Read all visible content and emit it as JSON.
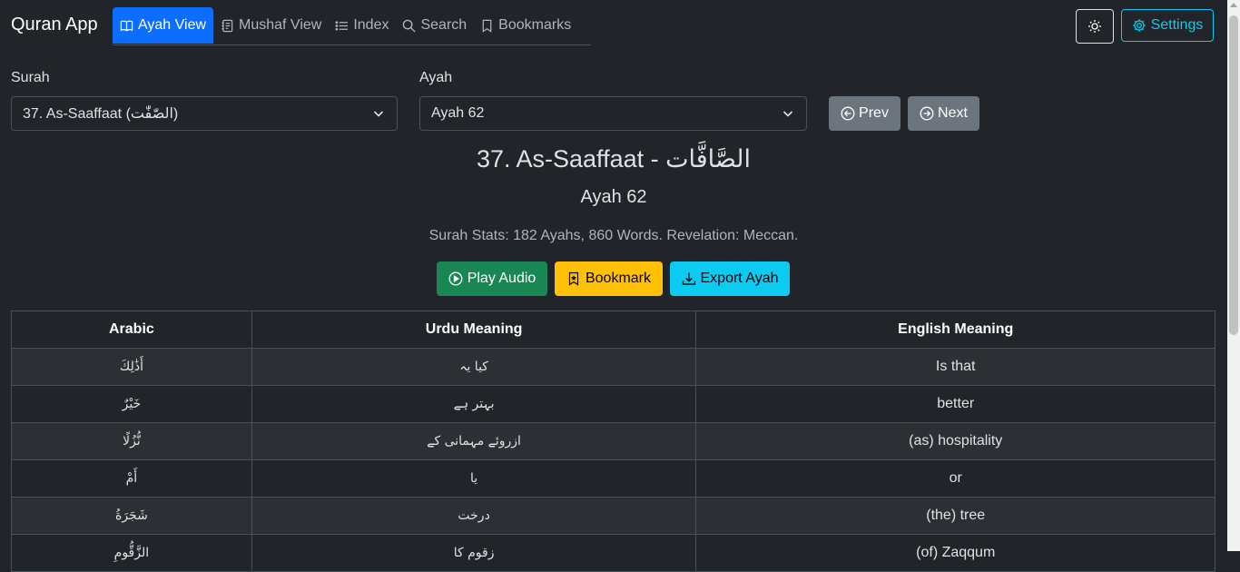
{
  "app": {
    "title": "Quran App"
  },
  "nav": {
    "tabs": [
      {
        "label": "Ayah View",
        "icon": "book-icon",
        "active": true
      },
      {
        "label": "Mushaf View",
        "icon": "journal-icon",
        "active": false
      },
      {
        "label": "Index",
        "icon": "list-icon",
        "active": false
      },
      {
        "label": "Search",
        "icon": "search-icon",
        "active": false
      },
      {
        "label": "Bookmarks",
        "icon": "bookmark-icon",
        "active": false
      }
    ],
    "theme_toggle_icon": "sun-icon",
    "settings_label": "Settings"
  },
  "selectors": {
    "surah_label": "Surah",
    "surah_value": "37. As-Saaffaat (الصّٰفّٰت)",
    "ayah_label": "Ayah",
    "ayah_value": "Ayah 62",
    "prev_label": "Prev",
    "next_label": "Next"
  },
  "header": {
    "surah_title": "37. As-Saaffaat - الصَّافَّات",
    "ayah_title": "Ayah 62",
    "stats": "Surah Stats: 182 Ayahs, 860 Words. Revelation: Meccan."
  },
  "actions": {
    "play_label": "Play Audio",
    "bookmark_label": "Bookmark",
    "export_label": "Export Ayah"
  },
  "table": {
    "headers": [
      "Arabic",
      "Urdu Meaning",
      "English Meaning"
    ],
    "rows": [
      {
        "arabic": "أَذَٰلِكَ",
        "urdu": "کیا یہ",
        "english": "Is that"
      },
      {
        "arabic": "خَيْرٌ",
        "urdu": "بہتر ہے",
        "english": "better"
      },
      {
        "arabic": "نُّزُلًا",
        "urdu": "ازروئے مہمانی کے",
        "english": "(as) hospitality"
      },
      {
        "arabic": "أَمْ",
        "urdu": "یا",
        "english": "or"
      },
      {
        "arabic": "شَجَرَةُ",
        "urdu": "درخت",
        "english": "(the) tree"
      },
      {
        "arabic": "الزَّقُّومِ",
        "urdu": "زقوم کا",
        "english": "(of) Zaqqum"
      }
    ]
  },
  "colors": {
    "background": "#212529",
    "primary": "#0d6efd",
    "success": "#198754",
    "warning": "#ffc107",
    "info": "#0dcaf0",
    "secondary": "#6c757d"
  }
}
